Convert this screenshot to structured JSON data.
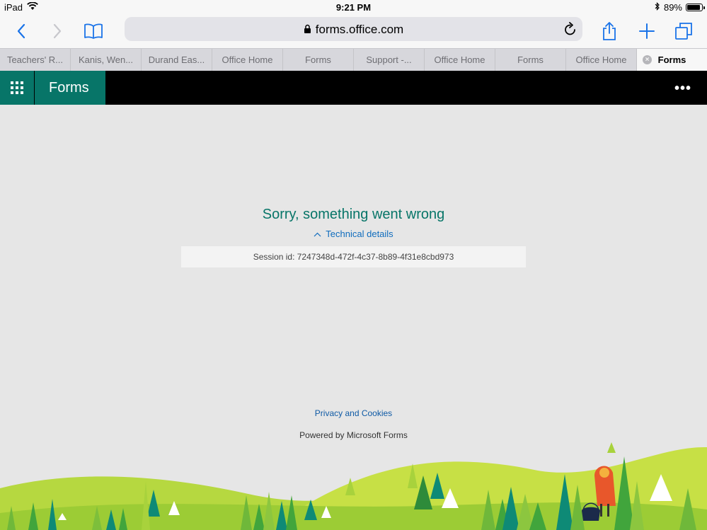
{
  "status_bar": {
    "device": "iPad",
    "time": "9:21 PM",
    "battery_percent_label": "89%",
    "battery_level": 0.89
  },
  "toolbar": {
    "url": "forms.office.com"
  },
  "tabs": [
    {
      "label": "Teachers' R..."
    },
    {
      "label": "Kanis, Wen..."
    },
    {
      "label": "Durand Eas..."
    },
    {
      "label": "Office Home"
    },
    {
      "label": "Forms"
    },
    {
      "label": "Support -..."
    },
    {
      "label": "Office Home"
    },
    {
      "label": "Forms"
    },
    {
      "label": "Office Home"
    },
    {
      "label": "Forms",
      "active": true
    }
  ],
  "appbar": {
    "brand": "Forms",
    "brand_color": "#077568"
  },
  "error": {
    "title": "Sorry, something went wrong",
    "details_link": "Technical details",
    "session": "Session id: 7247348d-472f-4c37-8b89-4f31e8cbd973"
  },
  "footer": {
    "privacy_link": "Privacy and Cookies",
    "powered_by": "Powered by Microsoft Forms"
  },
  "icons": [
    "wifi-icon",
    "bluetooth-icon",
    "battery-icon",
    "back-icon",
    "forward-icon",
    "bookmarks-icon",
    "lock-icon",
    "reload-icon",
    "share-icon",
    "new-tab-icon",
    "tabs-icon",
    "close-tab-icon",
    "app-launcher-icon",
    "more-icon",
    "chevron-up-icon"
  ]
}
